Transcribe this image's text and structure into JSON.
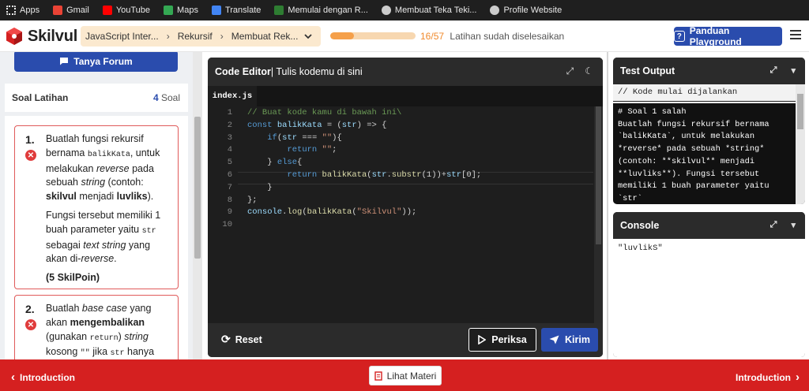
{
  "bookmarks": [
    {
      "label": "Apps",
      "icon": "apps-grid-icon",
      "color": "#e8e8e8"
    },
    {
      "label": "Gmail",
      "icon": "gmail-icon",
      "color": "#ea4335"
    },
    {
      "label": "YouTube",
      "icon": "youtube-icon",
      "color": "#ff0000"
    },
    {
      "label": "Maps",
      "icon": "maps-pin-icon",
      "color": "#34a853"
    },
    {
      "label": "Translate",
      "icon": "translate-icon",
      "color": "#4285f4"
    },
    {
      "label": "Memulai dengan R...",
      "icon": "r-logo-icon",
      "color": "#2e7d32"
    },
    {
      "label": "Membuat Teka Teki...",
      "icon": "puzzle-icon",
      "color": "#cccccc"
    },
    {
      "label": "Profile Website",
      "icon": "globe-icon",
      "color": "#cccccc"
    }
  ],
  "header": {
    "brand": "Skilvul",
    "breadcrumb": [
      "JavaScript Inter...",
      "Rekursif",
      "Membuat Rek..."
    ],
    "progress": {
      "done": "16",
      "total": "/57",
      "fraction": 0.28,
      "label": "Latihan sudah diselesaikan"
    },
    "guide_label": "Panduan Playground"
  },
  "left": {
    "forum_label": "Tanya Forum",
    "soal_title": "Soal Latihan",
    "soal_count": "4",
    "soal_unit": "Soal",
    "questions": [
      {
        "num": "1.",
        "p1_a": "Buatlah fungsi rekursif bernama ",
        "p1_code": "balikKata",
        "p1_b": ", untuk melakukan ",
        "p1_em": "reverse",
        "p1_c": " pada sebuah ",
        "p1_em2": "string",
        "p1_d": " (contoh: ",
        "p1_s1": "skilvul",
        "p1_e": " menjadi ",
        "p1_s2": "luvliks",
        "p1_f": ").",
        "p2_a": "Fungsi tersebut memiliki 1 buah parameter yaitu ",
        "p2_code": "str",
        "p2_b": " sebagai ",
        "p2_em": "text string",
        "p2_c": " yang akan di-",
        "p2_em2": "reverse",
        "p2_d": ".",
        "points": "(5 SkilPoin)"
      },
      {
        "num": "2.",
        "a": "Buatlah ",
        "em": "base case",
        "b": " yang akan ",
        "strong": "mengembalikan",
        "c": " (gunakan ",
        "code": "return",
        "d": ") ",
        "em2": "string",
        "e": " kosong ",
        "code2": "\"\"",
        "f": " jika ",
        "code3": "str",
        "g": " hanya"
      }
    ]
  },
  "editor": {
    "title_bold": "Code Editor",
    "title_rest": " | Tulis kodemu di sini",
    "tab": "index.js",
    "line_numbers": [
      "1",
      "2",
      "3",
      "4",
      "5",
      "6",
      "7",
      "8",
      "9",
      "10"
    ],
    "lines": [
      [
        {
          "c": "cm",
          "t": "// Buat kode kamu di bawah ini\\"
        }
      ],
      [
        {
          "c": "kw",
          "t": "const "
        },
        {
          "c": "id",
          "t": "balikKata"
        },
        {
          "c": "",
          "t": " = ("
        },
        {
          "c": "id",
          "t": "str"
        },
        {
          "c": "",
          "t": ") => {"
        }
      ],
      [
        {
          "c": "",
          "t": "    "
        },
        {
          "c": "kw",
          "t": "if"
        },
        {
          "c": "",
          "t": "("
        },
        {
          "c": "id",
          "t": "str"
        },
        {
          "c": "",
          "t": " === "
        },
        {
          "c": "st",
          "t": "\"\""
        },
        {
          "c": "",
          "t": "){"
        }
      ],
      [
        {
          "c": "",
          "t": "        "
        },
        {
          "c": "kw",
          "t": "return "
        },
        {
          "c": "st",
          "t": "\"\""
        },
        {
          "c": "",
          "t": ";"
        }
      ],
      [
        {
          "c": "",
          "t": "    } "
        },
        {
          "c": "kw",
          "t": "else"
        },
        {
          "c": "",
          "t": "{"
        }
      ],
      [
        {
          "c": "",
          "t": "        "
        },
        {
          "c": "kw",
          "t": "return "
        },
        {
          "c": "fn",
          "t": "balikKata"
        },
        {
          "c": "",
          "t": "("
        },
        {
          "c": "id",
          "t": "str"
        },
        {
          "c": "",
          "t": "."
        },
        {
          "c": "fn",
          "t": "substr"
        },
        {
          "c": "",
          "t": "(1))+"
        },
        {
          "c": "id",
          "t": "str"
        },
        {
          "c": "",
          "t": "[0];"
        }
      ],
      [
        {
          "c": "",
          "t": "    }"
        }
      ],
      [
        {
          "c": "",
          "t": "};"
        }
      ],
      [
        {
          "c": "id",
          "t": "console"
        },
        {
          "c": "",
          "t": "."
        },
        {
          "c": "fn",
          "t": "log"
        },
        {
          "c": "",
          "t": "("
        },
        {
          "c": "fn",
          "t": "balikKata"
        },
        {
          "c": "",
          "t": "("
        },
        {
          "c": "st",
          "t": "\"Skilvul\""
        },
        {
          "c": "",
          "t": "));"
        }
      ],
      []
    ],
    "reset_label": "Reset",
    "periksa_label": "Periksa",
    "kirim_label": "Kirim"
  },
  "test_output": {
    "title": "Test Output",
    "first_line": "// Kode mulai dijalankan",
    "text": "# Soal 1 salah\nBuatlah fungsi rekursif bernama\n`balikKata`, untuk melakukan\n*reverse* pada sebuah *string*\n(contoh: **skilvul** menjadi\n**luvliks**). Fungsi tersebut\nmemiliki 1 buah parameter yaitu `str`\nsebagai *text string* yang akan di-"
  },
  "console": {
    "title": "Console",
    "output": "\"luvlikS\""
  },
  "footer": {
    "prev": "Introduction",
    "materi": "Lihat Materi",
    "next": "Introduction"
  },
  "colors": {
    "brand_blue": "#2a4cad",
    "footer_red": "#d52020",
    "progress": "#f5a04a",
    "error": "#e03c3c"
  }
}
